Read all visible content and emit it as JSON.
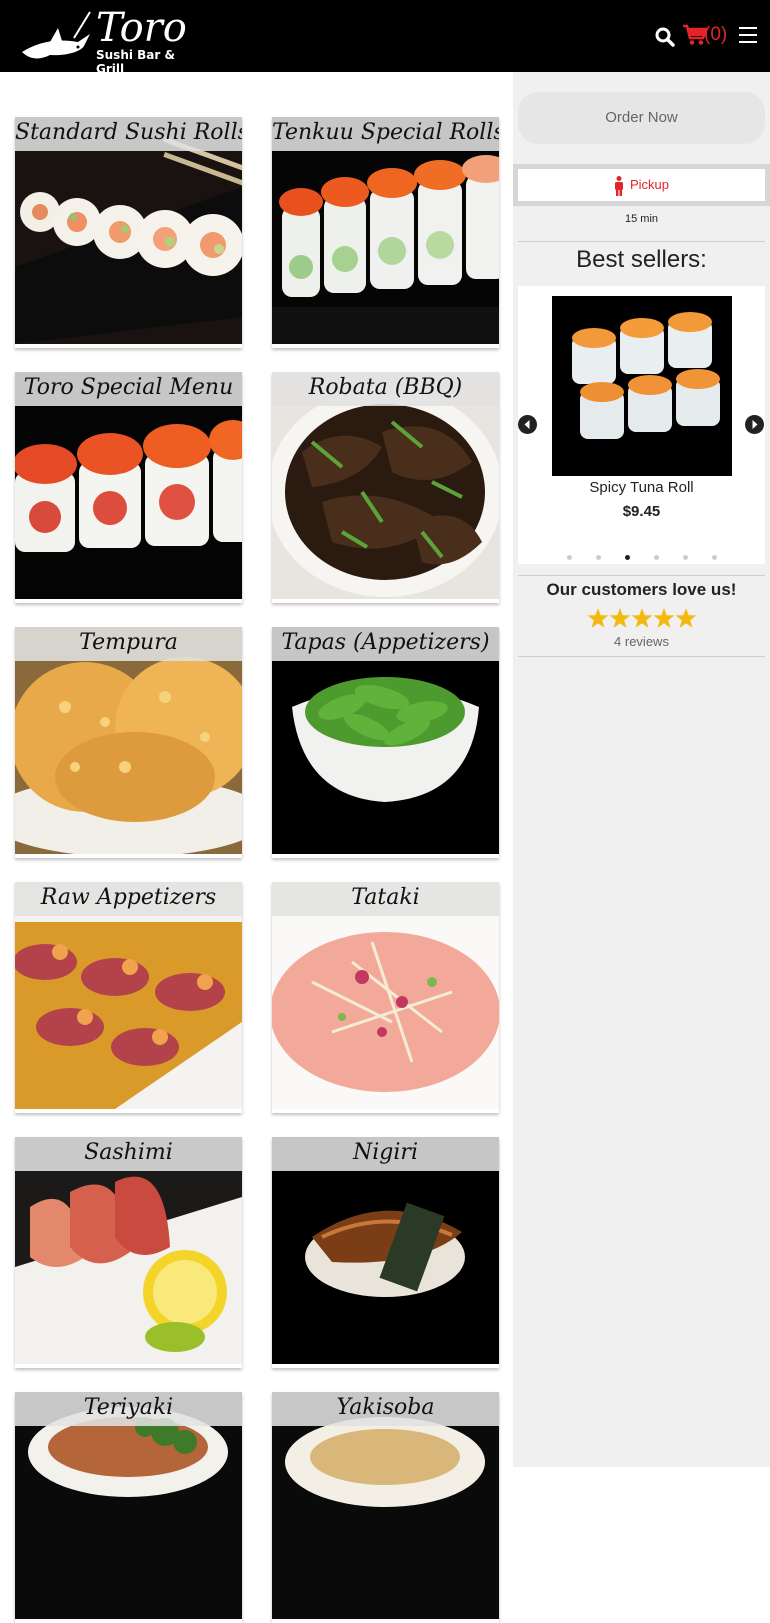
{
  "header": {
    "logo_word": "Toro",
    "logo_sub": "Sushi Bar & Grill",
    "cart_count": "(0)",
    "accent": "#e3242b",
    "bg": "#000000"
  },
  "categories": [
    {
      "label": "Standard Sushi Rolls",
      "icon": "sushi-roll-photo"
    },
    {
      "label": "Tenkuu Special Rolls",
      "icon": "special-roll-photo"
    },
    {
      "label": "Toro Special Menu",
      "icon": "toro-roll-photo"
    },
    {
      "label": "Robata (BBQ)",
      "icon": "bbq-photo"
    },
    {
      "label": "Tempura",
      "icon": "tempura-photo"
    },
    {
      "label": "Tapas (Appetizers)",
      "icon": "edamame-photo"
    },
    {
      "label": "Raw Appetizers",
      "icon": "beef-tataki-photo"
    },
    {
      "label": "Tataki",
      "icon": "fish-tataki-photo"
    },
    {
      "label": "Sashimi",
      "icon": "sashimi-photo"
    },
    {
      "label": "Nigiri",
      "icon": "nigiri-photo"
    },
    {
      "label": "Teriyaki",
      "icon": "teriyaki-photo"
    },
    {
      "label": "Yakisoba",
      "icon": "yakisoba-photo"
    }
  ],
  "sidebar": {
    "order_now": "Order Now",
    "pickup": "Pickup",
    "eta": "15 min",
    "best_sellers_title": "Best sellers:",
    "carousel": {
      "item_name": "Spicy Tuna Roll",
      "item_price": "$9.45",
      "slide_count": 6,
      "active_slide": 3
    },
    "reviews_title": "Our customers love us!",
    "rating": 5,
    "reviews_count": "4 reviews",
    "star_color": "#f3b90f"
  }
}
